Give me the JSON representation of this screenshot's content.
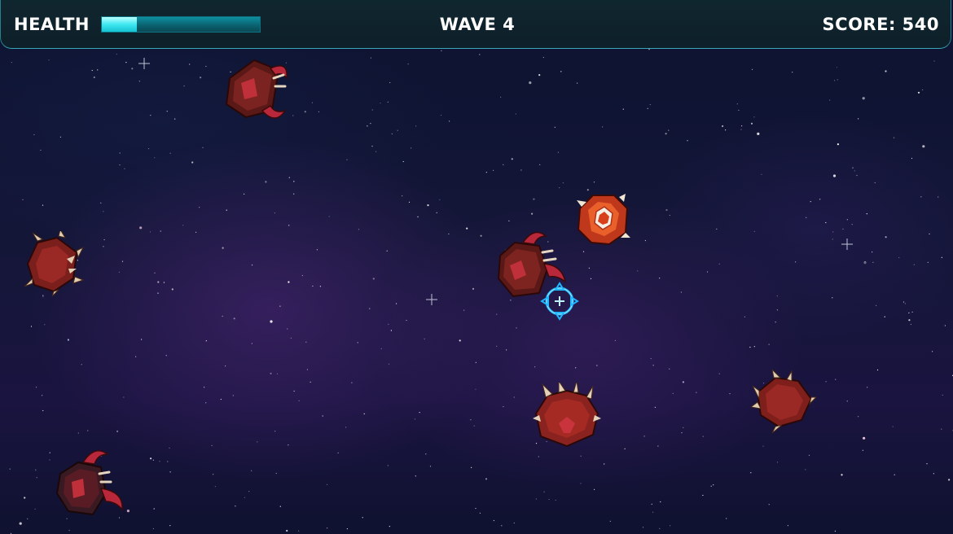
{
  "hud": {
    "health_label": "HEALTH",
    "health_fraction": 0.22,
    "wave_label": "WAVE 4",
    "score_label": "SCORE: 540"
  },
  "colors": {
    "health_fill": "#3fe7f0",
    "health_track": "#0a5f6d",
    "enemy_body": "#7a1e1a",
    "enemy_spike": "#d6c3a8",
    "crosshair": "#1fb6ff"
  },
  "enemies": [
    {
      "kind": "clawed-enemy"
    },
    {
      "kind": "spiked-enemy"
    },
    {
      "kind": "armored-enemy"
    },
    {
      "kind": "clawed-enemy"
    },
    {
      "kind": "horned-enemy"
    },
    {
      "kind": "spiked-enemy"
    },
    {
      "kind": "clawed-enemy"
    }
  ]
}
